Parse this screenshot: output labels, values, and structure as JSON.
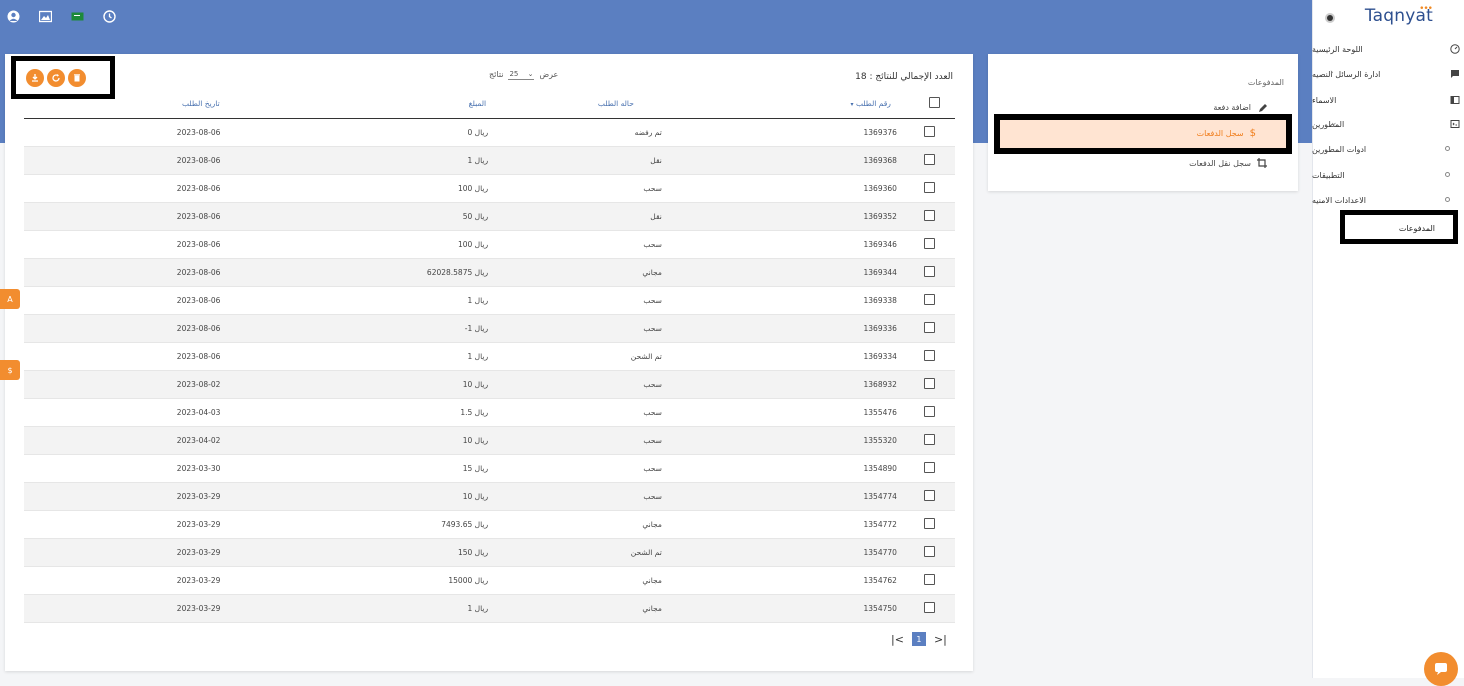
{
  "app": {
    "logo": "Taqnyat",
    "logo_dots": "•••"
  },
  "topbar": {
    "icons": [
      "user-icon",
      "image-icon",
      "flag-icon",
      "clock-icon"
    ]
  },
  "sidebar": {
    "items": [
      {
        "label": "اللوحة الرئيسية",
        "icon": "dashboard-icon"
      },
      {
        "label": "ادارة الرسائل النصيه",
        "icon": "message-icon"
      },
      {
        "label": "الاسماء",
        "icon": "book-icon"
      },
      {
        "label": "المطورين",
        "icon": "dev-icon"
      }
    ],
    "sub_items": [
      {
        "label": "ادوات المطورين"
      },
      {
        "label": "التطبيقات"
      },
      {
        "label": "الاعدادات الامنيه"
      }
    ],
    "active_item": "المدفوعات"
  },
  "payments_menu": {
    "title": "المدفوعات",
    "add_payment": "اضافة دفعة",
    "payments_log": "سجل الدفعات",
    "transfer_log": "سجل نقل الدفعات"
  },
  "table_header": {
    "total_label": "العدد الإجمالي للنتائج :",
    "total_value": "18",
    "show_label": "عرض",
    "page_size": "25",
    "results_label": "نتائج"
  },
  "columns": {
    "order_number": "رقم الطلب",
    "order_status": "حاله الطلب",
    "amount": "المبلغ",
    "order_date": "تاريخ الطلب"
  },
  "rows": [
    {
      "num": "1369376",
      "status": "تم رفضه",
      "amount": "0 ريال",
      "date": "2023-08-06"
    },
    {
      "num": "1369368",
      "status": "نقل",
      "amount": "1 ريال",
      "date": "2023-08-06"
    },
    {
      "num": "1369360",
      "status": "سحب",
      "amount": "100 ريال",
      "date": "2023-08-06"
    },
    {
      "num": "1369352",
      "status": "نقل",
      "amount": "50 ريال",
      "date": "2023-08-06"
    },
    {
      "num": "1369346",
      "status": "سحب",
      "amount": "100 ريال",
      "date": "2023-08-06"
    },
    {
      "num": "1369344",
      "status": "مجاني",
      "amount": "62028.5875 ريال",
      "date": "2023-08-06"
    },
    {
      "num": "1369338",
      "status": "سحب",
      "amount": "1 ريال",
      "date": "2023-08-06"
    },
    {
      "num": "1369336",
      "status": "سحب",
      "amount": "-1 ريال",
      "date": "2023-08-06"
    },
    {
      "num": "1369334",
      "status": "تم الشحن",
      "amount": "1 ريال",
      "date": "2023-08-06"
    },
    {
      "num": "1368932",
      "status": "سحب",
      "amount": "10 ريال",
      "date": "2023-08-02"
    },
    {
      "num": "1355476",
      "status": "سحب",
      "amount": "1.5 ريال",
      "date": "2023-04-03"
    },
    {
      "num": "1355320",
      "status": "سحب",
      "amount": "10 ريال",
      "date": "2023-04-02"
    },
    {
      "num": "1354890",
      "status": "سحب",
      "amount": "15 ريال",
      "date": "2023-03-30"
    },
    {
      "num": "1354774",
      "status": "سحب",
      "amount": "10 ريال",
      "date": "2023-03-29"
    },
    {
      "num": "1354772",
      "status": "مجاني",
      "amount": "7493.65 ريال",
      "date": "2023-03-29"
    },
    {
      "num": "1354770",
      "status": "تم الشحن",
      "amount": "150 ريال",
      "date": "2023-03-29"
    },
    {
      "num": "1354762",
      "status": "مجاني",
      "amount": "15000 ريال",
      "date": "2023-03-29"
    },
    {
      "num": "1354750",
      "status": "مجاني",
      "amount": "1 ريال",
      "date": "2023-03-29"
    }
  ],
  "pagination": {
    "first": "|<",
    "current": "1",
    "last": ">|"
  },
  "side_tabs": {
    "tab1": "A",
    "tab2": "$"
  },
  "colors": {
    "topbar": "#5b7fc1",
    "accent": "#f28d2f",
    "highlight": "#ffe4d2"
  }
}
